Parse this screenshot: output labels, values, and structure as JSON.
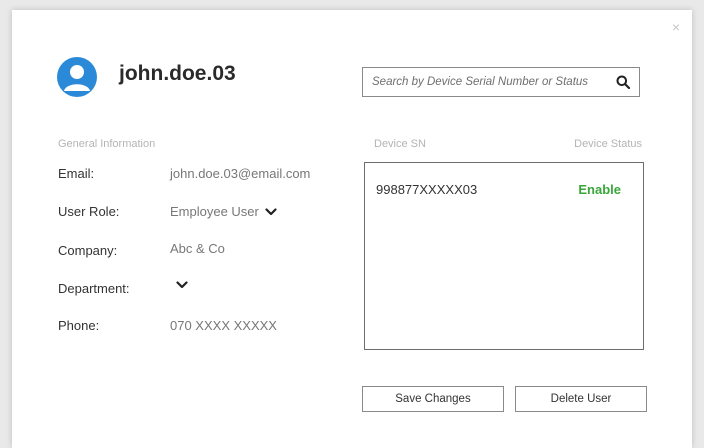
{
  "dialog": {
    "close_label": "×"
  },
  "user": {
    "username": "john.doe.03"
  },
  "search": {
    "placeholder": "Search by Device Serial Number or Status",
    "value": ""
  },
  "general": {
    "section_title": "General Information",
    "fields": [
      {
        "label": "Email:",
        "value": "john.doe.03@email.com"
      },
      {
        "label": "User Role:",
        "value": "Employee User"
      },
      {
        "label": "Company:",
        "value": "Abc & Co"
      },
      {
        "label": "Department:",
        "value": ""
      },
      {
        "label": "Phone:",
        "value": "070 XXXX XXXXX"
      }
    ]
  },
  "devices": {
    "columns": {
      "sn": "Device SN",
      "status": "Device Status"
    },
    "rows": [
      {
        "sn": "998877XXXXX03",
        "status": "Enable",
        "status_color": "#3aa53a"
      }
    ]
  },
  "actions": {
    "save_label": "Save Changes",
    "delete_label": "Delete User"
  },
  "colors": {
    "avatar": "#2b8ad8",
    "enable": "#3aa53a"
  }
}
